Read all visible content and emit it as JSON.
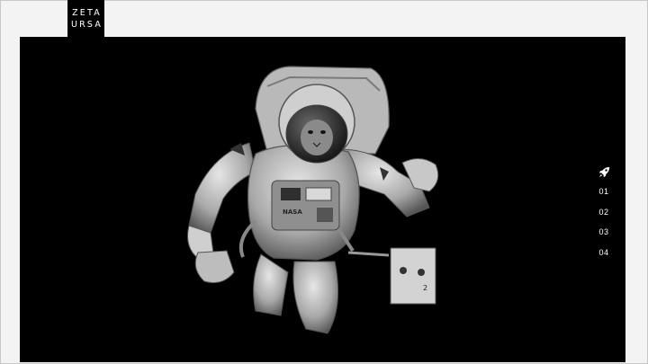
{
  "brand": {
    "line1": "ZETA",
    "line2": "URSA"
  },
  "hero": {
    "image": "astronaut-figure",
    "chest_text": "NASA"
  },
  "side_nav": {
    "icon": "rocket-icon",
    "items": [
      {
        "label": "01"
      },
      {
        "label": "02"
      },
      {
        "label": "03"
      },
      {
        "label": "04"
      }
    ]
  },
  "colors": {
    "background": "#000000",
    "frame": "#f3f3f3",
    "text": "#ffffff"
  }
}
